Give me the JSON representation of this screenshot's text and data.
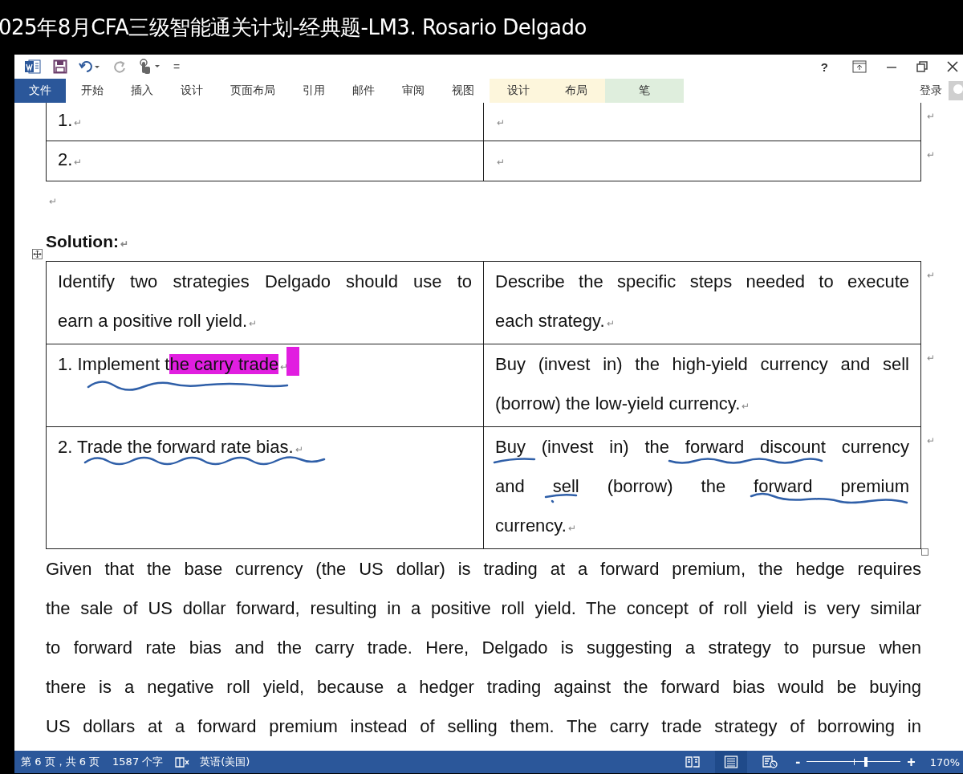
{
  "window": {
    "title": "025年8月CFA三级智能通关计划-经典题-LM3. Rosario Delgado"
  },
  "ribbon": {
    "tabs": [
      {
        "label": "文件",
        "selected": true,
        "kind": "file"
      },
      {
        "label": "开始",
        "selected": false,
        "kind": "plain"
      },
      {
        "label": "插入",
        "selected": false,
        "kind": "plain"
      },
      {
        "label": "设计",
        "selected": false,
        "kind": "plain"
      },
      {
        "label": "页面布局",
        "selected": false,
        "kind": "plain"
      },
      {
        "label": "引用",
        "selected": false,
        "kind": "plain"
      },
      {
        "label": "邮件",
        "selected": false,
        "kind": "plain"
      },
      {
        "label": "审阅",
        "selected": false,
        "kind": "plain"
      },
      {
        "label": "视图",
        "selected": false,
        "kind": "plain"
      },
      {
        "label": "设计",
        "selected": false,
        "kind": "context"
      },
      {
        "label": "布局",
        "selected": false,
        "kind": "context"
      },
      {
        "label": "笔",
        "selected": false,
        "kind": "pen"
      }
    ],
    "help": "?",
    "customize": "=",
    "sign_in": "登录"
  },
  "document": {
    "paragraph_mark": "↵",
    "top_table": [
      {
        "cells": [
          "1.",
          ""
        ]
      },
      {
        "cells": [
          "2.",
          ""
        ]
      }
    ],
    "heading": "Solution:",
    "solution_table": [
      {
        "cells": [
          {
            "lines": [
              "Identify two strategies Delgado should use to",
              "earn a positive roll yield."
            ]
          },
          {
            "lines": [
              "Describe the specific steps needed to execute",
              "each strategy."
            ]
          }
        ]
      },
      {
        "cells": [
          {
            "lines": [
              "1. Implement t"
            ],
            "highlight": "he carry trade"
          },
          {
            "lines": [
              "Buy (invest in) the high-yield currency and sell",
              "(borrow) the low-yield currency."
            ]
          }
        ]
      },
      {
        "cells": [
          {
            "lines": [
              "2. Trade the forward rate bias."
            ]
          },
          {
            "lines": [
              "Buy (invest in) the forward discount currency",
              "and sell (borrow) the forward premium",
              "currency."
            ]
          }
        ]
      }
    ],
    "body_lines": [
      "Given that the base currency (the US dollar) is trading at a forward premium, the hedge requires",
      "the sale of US dollar forward, resulting in a positive roll yield. The concept of roll yield is very similar",
      "to forward rate bias and the carry trade. Here, Delgado is suggesting a strategy to pursue when",
      "there is a negative roll yield, because a hedger trading against the forward bias would be buying",
      "US dollars at a forward premium instead of selling them. The carry trade strategy of borrowing in"
    ]
  },
  "status_bar": {
    "page": "第 6 页，共 6 页",
    "words": "1587 个字",
    "language": "英语(美国)",
    "views": [
      {
        "kind": "read",
        "selected": false
      },
      {
        "kind": "print",
        "selected": true
      },
      {
        "kind": "web",
        "selected": false
      }
    ],
    "zoom_minus": "-",
    "zoom_plus": "+",
    "zoom": {
      "level": 0.63
    },
    "zoom_text": "170%"
  }
}
